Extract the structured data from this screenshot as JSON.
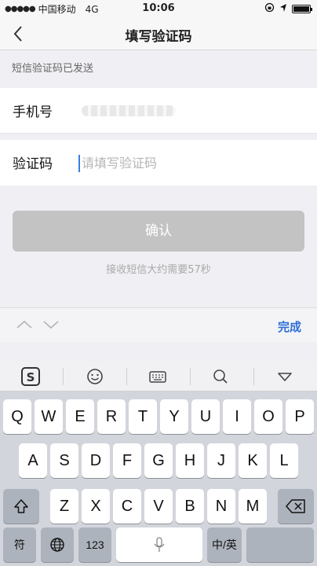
{
  "status_bar": {
    "carrier": "中国移动",
    "network": "4G",
    "time": "10:06"
  },
  "nav": {
    "title": "填写验证码"
  },
  "notice": "短信验证码已发送",
  "form": {
    "phone_label": "手机号",
    "code_label": "验证码",
    "code_placeholder": "请填写验证码",
    "code_value": ""
  },
  "confirm_label": "确认",
  "countdown_text": "接收短信大约需要57秒",
  "accessory": {
    "done_label": "完成"
  },
  "keyboard": {
    "row1": [
      "Q",
      "W",
      "E",
      "R",
      "T",
      "Y",
      "U",
      "I",
      "O",
      "P"
    ],
    "row2": [
      "A",
      "S",
      "D",
      "F",
      "G",
      "H",
      "J",
      "K",
      "L"
    ],
    "row3": [
      "Z",
      "X",
      "C",
      "V",
      "B",
      "N",
      "M"
    ],
    "symbol_label": "符",
    "num_label": "123",
    "lang_label": "中/英",
    "toolbar_icons": [
      "sogou-logo-icon",
      "emoji-icon",
      "keyboard-icon",
      "search-icon",
      "collapse-icon"
    ]
  },
  "colors": {
    "accent": "#2f6fd6",
    "disabled_button": "#c3c3c3",
    "keyboard_bg": "#d2d5db"
  }
}
